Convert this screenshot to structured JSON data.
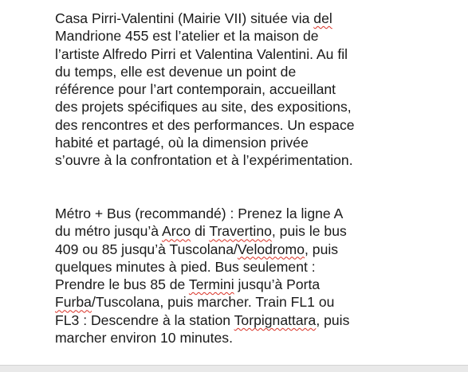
{
  "document": {
    "paragraph_1": [
      [
        "Casa Pirri-Valentini (Mairie VII) située via ",
        {
          "t": "del",
          "sq": true
        }
      ],
      [
        "Mandrione 455 est l’atelier et la maison de"
      ],
      [
        "l’artiste Alfredo Pirri et Valentina Valentini. Au fil"
      ],
      [
        "du temps, elle est devenue un point de"
      ],
      [
        "référence pour l’art contemporain, accueillant"
      ],
      [
        "des projets spécifiques au site, des expositions,"
      ],
      [
        "des rencontres et des performances. Un espace"
      ],
      [
        "habité et partagé, où la dimension privée"
      ],
      [
        "s’ouvre à la confrontation et à l’expérimentation."
      ]
    ],
    "paragraph_2": [
      [
        "Métro + Bus (recommandé) : Prenez la ligne A"
      ],
      [
        "du métro jusqu’à ",
        {
          "t": "Arco",
          "sq": true
        },
        " di ",
        {
          "t": "Travertino",
          "sq": true
        },
        ", puis le bus"
      ],
      [
        "409 ou 85 jusqu’à Tuscolana/",
        {
          "t": "Velodromo",
          "sq": true
        },
        ", puis"
      ],
      [
        "quelques minutes à pied. Bus seulement :"
      ],
      [
        "Prendre le bus 85 de ",
        {
          "t": "Termini",
          "sq": true
        },
        " jusqu’à Porta"
      ],
      [
        {
          "t": "Furba",
          "sq": true
        },
        "/Tuscolana, puis marcher. Train FL1 ou"
      ],
      [
        "FL3 : Descendre à la station ",
        {
          "t": "Torpignattara",
          "sq": true
        },
        ", puis"
      ],
      [
        "marcher environ 10 minutes."
      ]
    ]
  },
  "colors": {
    "text": "#1a1a1a",
    "spellcheck_underline": "#d93025",
    "background": "#ffffff"
  }
}
